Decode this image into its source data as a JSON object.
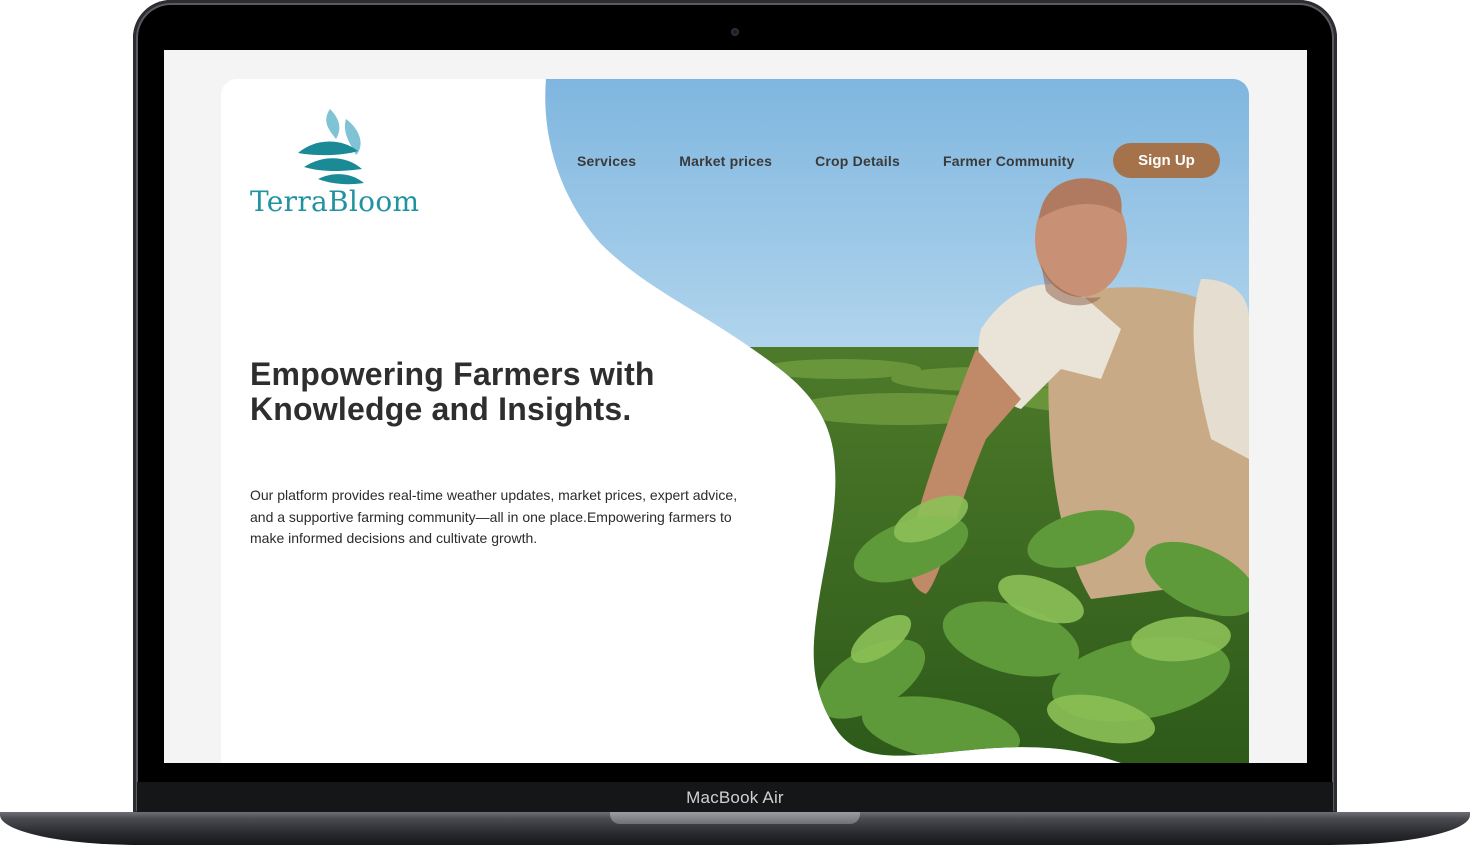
{
  "device": {
    "label": "MacBook Air"
  },
  "brand": {
    "name": "TerraBloom",
    "color": "#2193a0"
  },
  "nav": {
    "items": [
      {
        "label": "Services"
      },
      {
        "label": "Market prices"
      },
      {
        "label": "Crop Details"
      },
      {
        "label": "Farmer Community"
      }
    ],
    "cta": {
      "label": "Sign Up",
      "color": "#a5734b"
    }
  },
  "hero": {
    "headline": "Empowering Farmers with Knowledge and Insights.",
    "description": "Our platform provides real-time weather updates, market prices, expert advice, and a supportive farming community—all in one place.Empowering farmers to make informed decisions and cultivate growth.",
    "image": "farmer-in-soybean-field"
  }
}
